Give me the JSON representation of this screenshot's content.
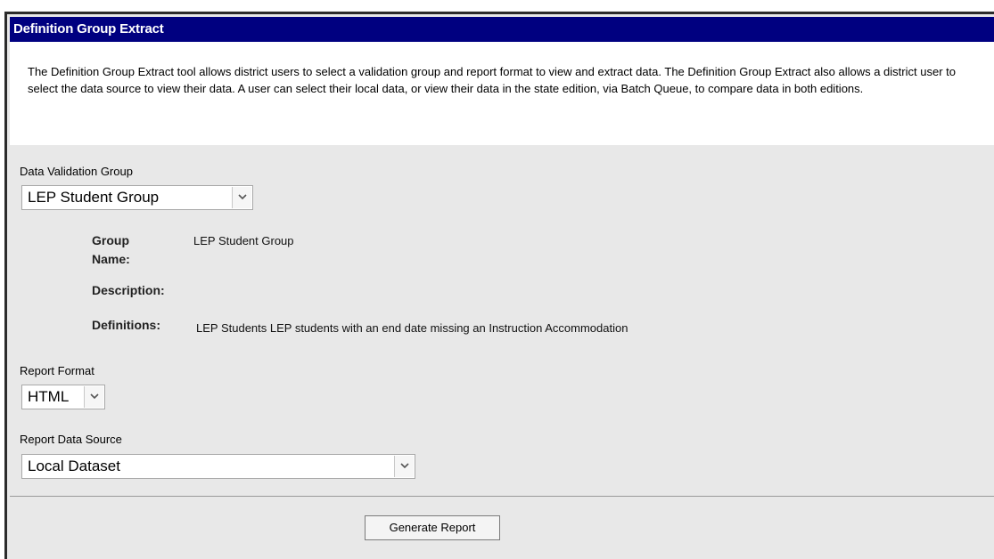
{
  "window": {
    "title": "Definition Group Extract"
  },
  "intro": {
    "text": "The Definition Group Extract tool allows district users to select a validation group and report format to view and extract data. The Definition Group Extract also allows a district user to select the data source to view their data. A user can select their local data, or view their data in the state edition, via Batch Queue, to compare data in both editions."
  },
  "validation_group": {
    "label": "Data Validation Group",
    "selected": "LEP Student Group"
  },
  "group_info": {
    "group_name_label_line1": "Group",
    "group_name_label_line2": "Name:",
    "group_name_value": "LEP Student Group",
    "description_label": "Description:",
    "definitions_label": "Definitions:",
    "definitions_value": "LEP Students LEP students with an end date missing an Instruction Accommodation"
  },
  "report_format": {
    "label": "Report Format",
    "selected": "HTML"
  },
  "data_source": {
    "label": "Report Data Source",
    "selected": "Local Dataset"
  },
  "actions": {
    "generate_label": "Generate Report"
  },
  "icons": {
    "dropdown": "chevron-down-icon"
  },
  "colors": {
    "title_bar": "#000080",
    "panel_background": "#e8e8e8"
  }
}
